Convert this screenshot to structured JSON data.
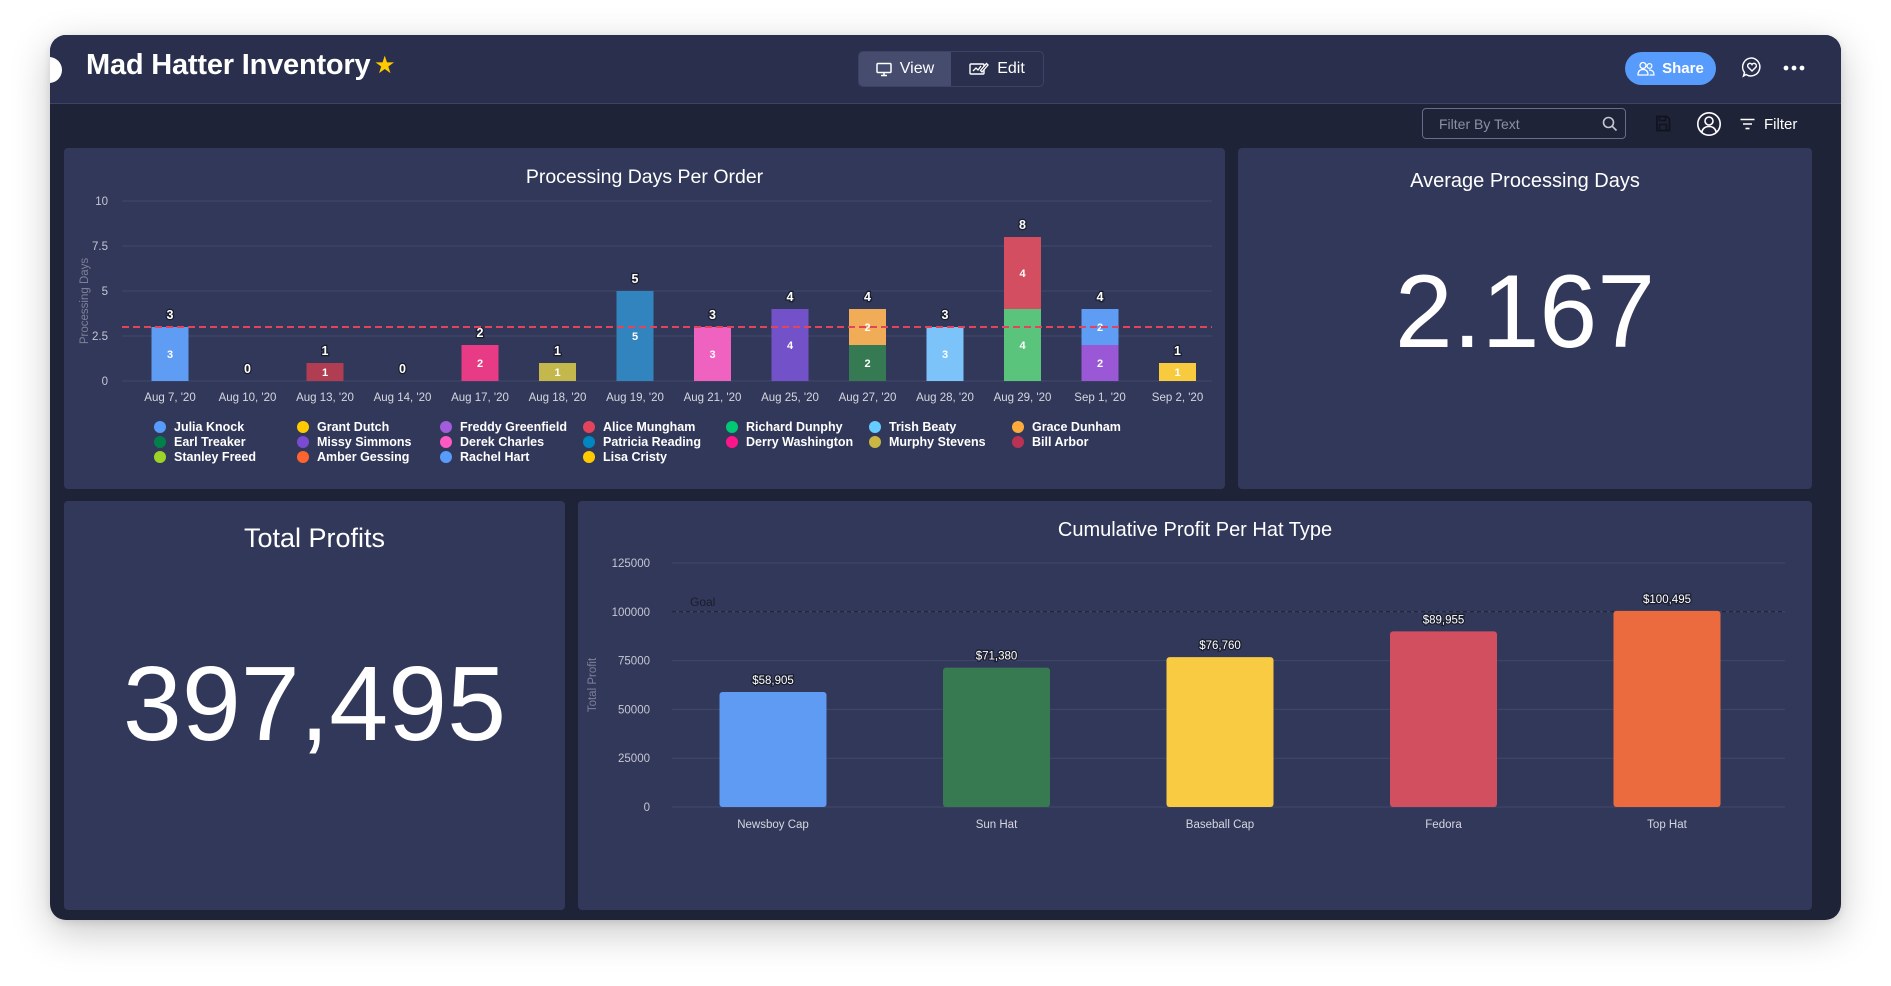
{
  "header": {
    "title": "Mad Hatter Inventory",
    "favorite_icon": "star-icon",
    "view_label": "View",
    "edit_label": "Edit",
    "share_label": "Share",
    "icons": [
      "monitor-icon",
      "edit-pencil-icon",
      "people-icon",
      "chat-heart-icon",
      "more-dots-icon"
    ]
  },
  "toolbar": {
    "filter_placeholder": "Filter By Text",
    "filter_value": "",
    "filter_label": "Filter",
    "icons": [
      "search-icon",
      "save-icon",
      "person-icon",
      "filter-icon"
    ]
  },
  "colors": {
    "header_bg": "#292f4c",
    "body_bg": "#1f2337",
    "panel_bg": "#323859",
    "accent": "#579bfc",
    "reference_line": "#e2445c"
  },
  "widgets": {
    "avg_processing": {
      "title": "Average Processing Days",
      "value": "2.167"
    },
    "total_profits": {
      "title": "Total Profits",
      "value": "397,495"
    }
  },
  "chart_data": [
    {
      "type": "bar",
      "stacked": true,
      "title": "Processing Days Per Order",
      "xlabel": "",
      "ylabel": "Processing Days",
      "ylim": [
        0,
        10
      ],
      "yticks": [
        "0",
        "2.5",
        "5",
        "7.5",
        "10"
      ],
      "grid": true,
      "reference_line": {
        "value": 3,
        "style": "dashed",
        "color": "#e2445c"
      },
      "categories": [
        "Aug 7, '20",
        "Aug 10, '20",
        "Aug 13, '20",
        "Aug 14, '20",
        "Aug 17, '20",
        "Aug 18, '20",
        "Aug 19, '20",
        "Aug 21, '20",
        "Aug 25, '20",
        "Aug 27, '20",
        "Aug 28, '20",
        "Aug 29, '20",
        "Sep 1, '20",
        "Sep 2, '20"
      ],
      "totals": [
        3,
        0,
        1,
        0,
        2,
        1,
        5,
        3,
        4,
        4,
        3,
        8,
        4,
        1
      ],
      "stacks": [
        [
          {
            "name": "Julia Knock",
            "value": 3
          }
        ],
        [],
        [
          {
            "name": "Bill Arbor",
            "value": 1
          }
        ],
        [],
        [
          {
            "name": "Derry Washington",
            "value": 2
          }
        ],
        [
          {
            "name": "Murphy Stevens",
            "value": 1
          }
        ],
        [
          {
            "name": "Patricia Reading",
            "value": 5
          }
        ],
        [
          {
            "name": "Derek Charles",
            "value": 3
          }
        ],
        [
          {
            "name": "Missy Simmons",
            "value": 4
          }
        ],
        [
          {
            "name": "Earl Treaker",
            "value": 2
          },
          {
            "name": "Grace Dunham",
            "value": 2
          }
        ],
        [
          {
            "name": "Trish Beaty",
            "value": 3
          }
        ],
        [
          {
            "name": "Richard Dunphy",
            "value": 4
          },
          {
            "name": "Alice Mungham",
            "value": 4
          }
        ],
        [
          {
            "name": "Freddy Greenfield",
            "value": 2
          },
          {
            "name": "Rachel Hart",
            "value": 2
          }
        ],
        [
          {
            "name": "Lisa Cristy",
            "value": 1
          }
        ]
      ],
      "legend": {
        "placement": "bottom",
        "columns": [
          [
            {
              "name": "Julia Knock",
              "color": "#579bfc"
            },
            {
              "name": "Earl Treaker",
              "color": "#037f4c"
            },
            {
              "name": "Stanley Freed",
              "color": "#9cd326"
            }
          ],
          [
            {
              "name": "Grant Dutch",
              "color": "#ffcb00"
            },
            {
              "name": "Missy Simmons",
              "color": "#784bd1"
            },
            {
              "name": "Amber Gessing",
              "color": "#ff642e"
            }
          ],
          [
            {
              "name": "Freddy Greenfield",
              "color": "#a25ddc"
            },
            {
              "name": "Derek Charles",
              "color": "#ff5ac4"
            },
            {
              "name": "Rachel Hart",
              "color": "#579bfc"
            }
          ],
          [
            {
              "name": "Alice Mungham",
              "color": "#e2445c"
            },
            {
              "name": "Patricia Reading",
              "color": "#0086c0"
            },
            {
              "name": "Lisa Cristy",
              "color": "#ffcb00"
            }
          ],
          [
            {
              "name": "Richard Dunphy",
              "color": "#00c875"
            },
            {
              "name": "Derry Washington",
              "color": "#ff158a"
            }
          ],
          [
            {
              "name": "Trish Beaty",
              "color": "#66ccff"
            },
            {
              "name": "Murphy Stevens",
              "color": "#cab641"
            }
          ],
          [
            {
              "name": "Grace Dunham",
              "color": "#fdab3d"
            },
            {
              "name": "Bill Arbor",
              "color": "#bb3354"
            }
          ]
        ]
      },
      "series_colors": {
        "Julia Knock": "#5f9cf3",
        "Earl Treaker": "#357a52",
        "Stanley Freed": "#c4c04f",
        "Grant Dutch": "#f8cb3f",
        "Missy Simmons": "#7352c9",
        "Amber Gessing": "#ec6b3d",
        "Freddy Greenfield": "#9a58d6",
        "Derek Charles": "#ef62c0",
        "Rachel Hart": "#5f9cf3",
        "Alice Mungham": "#d34e60",
        "Patricia Reading": "#3284bf",
        "Lisa Cristy": "#f8cb3f",
        "Richard Dunphy": "#5ac47c",
        "Derry Washington": "#e73b86",
        "Trish Beaty": "#7bc3f8",
        "Murphy Stevens": "#c4b84d",
        "Grace Dunham": "#f1ac57",
        "Bill Arbor": "#b13d52"
      }
    },
    {
      "type": "bar",
      "title": "Cumulative Profit Per Hat Type",
      "xlabel": "",
      "ylabel": "Total Profit",
      "ylim": [
        0,
        125000
      ],
      "yticks": [
        "0",
        "25000",
        "50000",
        "75000",
        "100000",
        "125000"
      ],
      "grid": true,
      "goal_line": {
        "label": "Goal",
        "value": 100000,
        "style": "dashed"
      },
      "categories": [
        "Newsboy Cap",
        "Sun Hat",
        "Baseball Cap",
        "Fedora",
        "Top Hat"
      ],
      "values": [
        58905,
        71380,
        76760,
        89955,
        100495
      ],
      "value_labels": [
        "$58,905",
        "$71,380",
        "$76,760",
        "$89,955",
        "$100,495"
      ],
      "colors": [
        "#5f9af3",
        "#377a51",
        "#f8cb42",
        "#d24f60",
        "#ec6b3e"
      ]
    }
  ]
}
